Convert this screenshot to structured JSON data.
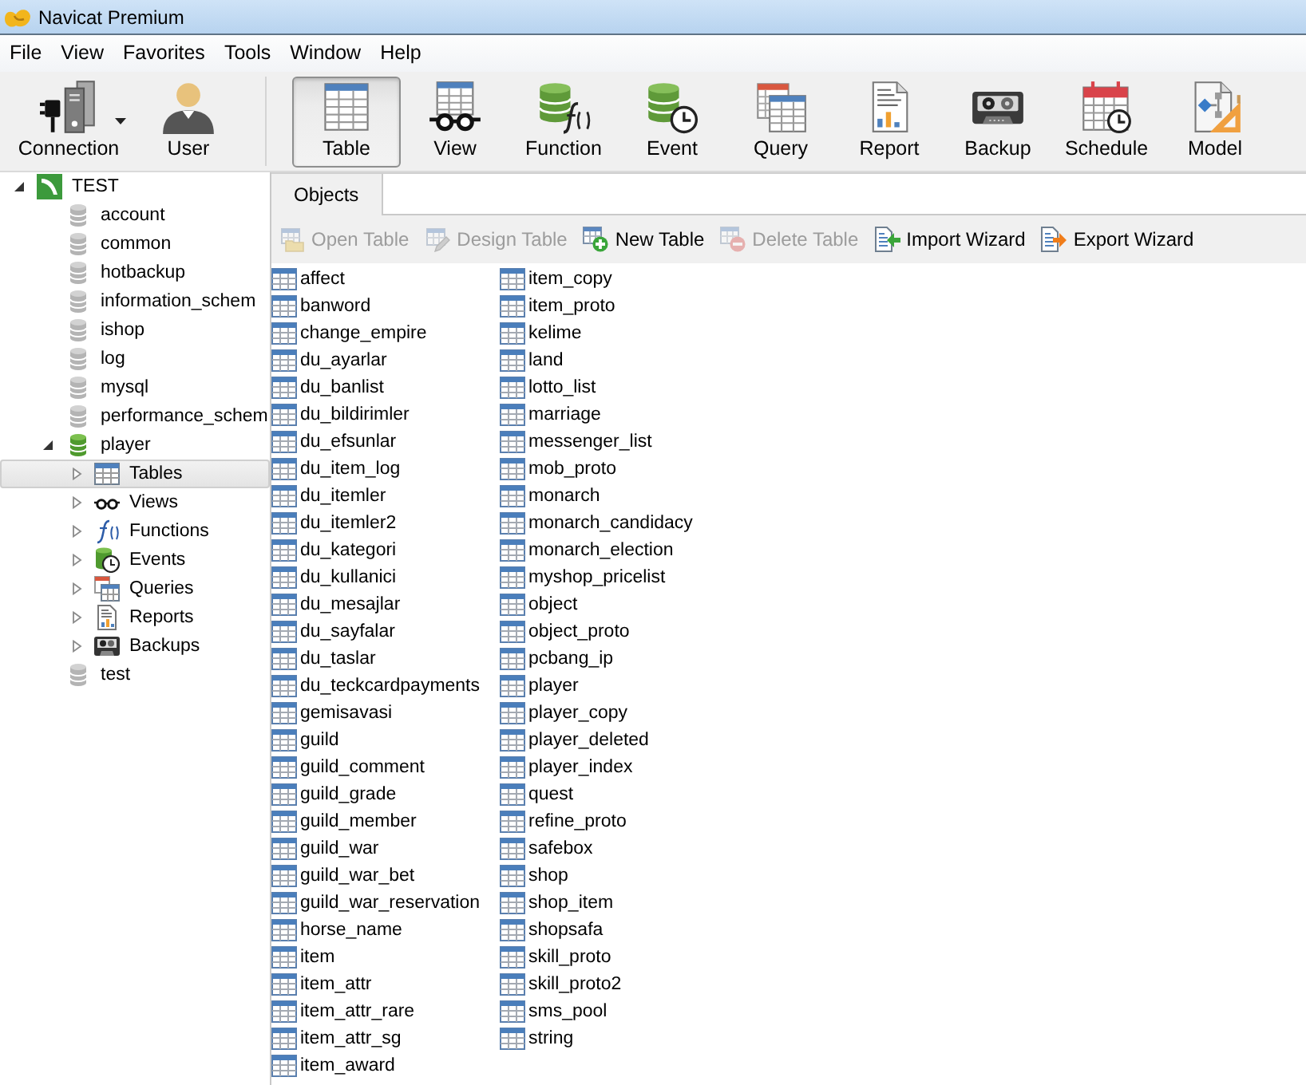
{
  "window": {
    "title": "Navicat Premium"
  },
  "menu": [
    "File",
    "View",
    "Favorites",
    "Tools",
    "Window",
    "Help"
  ],
  "toolbar": {
    "tools": [
      {
        "kind": "connection",
        "label": "Connection",
        "dropdown": true
      },
      {
        "kind": "user",
        "label": "User",
        "dropdown": false
      }
    ],
    "object_types": [
      {
        "kind": "table",
        "label": "Table",
        "selected": true
      },
      {
        "kind": "view",
        "label": "View",
        "selected": false
      },
      {
        "kind": "function",
        "label": "Function",
        "selected": false
      },
      {
        "kind": "event",
        "label": "Event",
        "selected": false
      },
      {
        "kind": "query",
        "label": "Query",
        "selected": false
      },
      {
        "kind": "report",
        "label": "Report",
        "selected": false
      },
      {
        "kind": "backup",
        "label": "Backup",
        "selected": false
      },
      {
        "kind": "schedule",
        "label": "Schedule",
        "selected": false
      },
      {
        "kind": "model",
        "label": "Model",
        "selected": false
      }
    ]
  },
  "sidebar": {
    "tree": [
      {
        "kind": "server",
        "label": "TEST",
        "expanded": true,
        "selected": false,
        "children": [
          {
            "kind": "database",
            "label": "account",
            "open": false,
            "selected": false
          },
          {
            "kind": "database",
            "label": "common",
            "open": false,
            "selected": false
          },
          {
            "kind": "database",
            "label": "hotbackup",
            "open": false,
            "selected": false
          },
          {
            "kind": "database",
            "label": "information_schem",
            "open": false,
            "selected": false
          },
          {
            "kind": "database",
            "label": "ishop",
            "open": false,
            "selected": false
          },
          {
            "kind": "database",
            "label": "log",
            "open": false,
            "selected": false
          },
          {
            "kind": "database",
            "label": "mysql",
            "open": false,
            "selected": false
          },
          {
            "kind": "database",
            "label": "performance_schem",
            "open": false,
            "selected": false
          },
          {
            "kind": "database",
            "label": "player",
            "open": true,
            "expanded": true,
            "selected": false,
            "children": [
              {
                "kind": "tables",
                "label": "Tables",
                "expanded": false,
                "selected": true
              },
              {
                "kind": "views",
                "label": "Views",
                "expanded": false,
                "selected": false
              },
              {
                "kind": "functions",
                "label": "Functions",
                "expanded": false,
                "selected": false
              },
              {
                "kind": "events",
                "label": "Events",
                "expanded": false,
                "selected": false
              },
              {
                "kind": "queries",
                "label": "Queries",
                "expanded": false,
                "selected": false
              },
              {
                "kind": "reports",
                "label": "Reports",
                "expanded": false,
                "selected": false
              },
              {
                "kind": "backups",
                "label": "Backups",
                "expanded": false,
                "selected": false
              }
            ]
          },
          {
            "kind": "database",
            "label": "test",
            "open": false,
            "selected": false
          }
        ]
      }
    ]
  },
  "tabs": [
    {
      "label": "Objects",
      "selected": true
    }
  ],
  "object_toolbar": [
    {
      "kind": "open",
      "label": "Open Table",
      "disabled": true
    },
    {
      "kind": "design",
      "label": "Design Table",
      "disabled": true
    },
    {
      "kind": "new",
      "label": "New Table",
      "disabled": false
    },
    {
      "kind": "delete",
      "label": "Delete Table",
      "disabled": true
    },
    {
      "kind": "import",
      "label": "Import Wizard",
      "disabled": false
    },
    {
      "kind": "export",
      "label": "Export Wizard",
      "disabled": false
    }
  ],
  "objects": [
    {
      "name": "affect",
      "selected": false
    },
    {
      "name": "banword",
      "selected": false
    },
    {
      "name": "change_empire",
      "selected": false
    },
    {
      "name": "du_ayarlar",
      "selected": false
    },
    {
      "name": "du_banlist",
      "selected": false
    },
    {
      "name": "du_bildirimler",
      "selected": false
    },
    {
      "name": "du_efsunlar",
      "selected": false
    },
    {
      "name": "du_item_log",
      "selected": false
    },
    {
      "name": "du_itemler",
      "selected": false
    },
    {
      "name": "du_itemler2",
      "selected": false
    },
    {
      "name": "du_kategori",
      "selected": false
    },
    {
      "name": "du_kullanici",
      "selected": false
    },
    {
      "name": "du_mesajlar",
      "selected": false
    },
    {
      "name": "du_sayfalar",
      "selected": false
    },
    {
      "name": "du_taslar",
      "selected": false
    },
    {
      "name": "du_teckcardpayments",
      "selected": false
    },
    {
      "name": "gemisavasi",
      "selected": false
    },
    {
      "name": "guild",
      "selected": false
    },
    {
      "name": "guild_comment",
      "selected": false
    },
    {
      "name": "guild_grade",
      "selected": false
    },
    {
      "name": "guild_member",
      "selected": false
    },
    {
      "name": "guild_war",
      "selected": false
    },
    {
      "name": "guild_war_bet",
      "selected": false
    },
    {
      "name": "guild_war_reservation",
      "selected": false
    },
    {
      "name": "horse_name",
      "selected": false
    },
    {
      "name": "item",
      "selected": false
    },
    {
      "name": "item_attr",
      "selected": false
    },
    {
      "name": "item_attr_rare",
      "selected": false
    },
    {
      "name": "item_attr_sg",
      "selected": false
    },
    {
      "name": "item_award",
      "selected": false
    },
    {
      "name": "item_copy",
      "selected": false
    },
    {
      "name": "item_proto",
      "selected": false
    },
    {
      "name": "kelime",
      "selected": false
    },
    {
      "name": "land",
      "selected": false
    },
    {
      "name": "lotto_list",
      "selected": false
    },
    {
      "name": "marriage",
      "selected": false
    },
    {
      "name": "messenger_list",
      "selected": false
    },
    {
      "name": "mob_proto",
      "selected": false
    },
    {
      "name": "monarch",
      "selected": false
    },
    {
      "name": "monarch_candidacy",
      "selected": false
    },
    {
      "name": "monarch_election",
      "selected": false
    },
    {
      "name": "myshop_pricelist",
      "selected": false
    },
    {
      "name": "object",
      "selected": false
    },
    {
      "name": "object_proto",
      "selected": false
    },
    {
      "name": "pcbang_ip",
      "selected": false
    },
    {
      "name": "player",
      "selected": false
    },
    {
      "name": "player_copy",
      "selected": false
    },
    {
      "name": "player_deleted",
      "selected": false
    },
    {
      "name": "player_index",
      "selected": false
    },
    {
      "name": "quest",
      "selected": false
    },
    {
      "name": "refine_proto",
      "selected": false
    },
    {
      "name": "safebox",
      "selected": false
    },
    {
      "name": "shop",
      "selected": false
    },
    {
      "name": "shop_item",
      "selected": false
    },
    {
      "name": "shopsafa",
      "selected": false
    },
    {
      "name": "skill_proto",
      "selected": false
    },
    {
      "name": "skill_proto2",
      "selected": false
    },
    {
      "name": "sms_pool",
      "selected": false
    },
    {
      "name": "string",
      "selected": false
    }
  ]
}
